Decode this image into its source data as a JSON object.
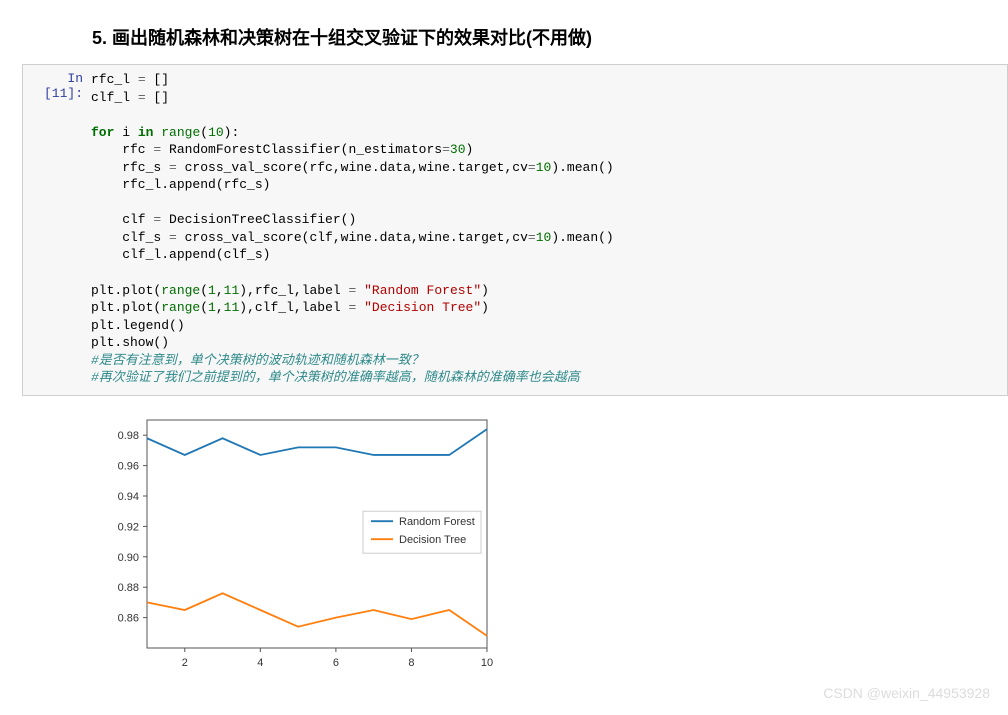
{
  "heading": "5. 画出随机森林和决策树在十组交叉验证下的效果对比(不用做)",
  "prompt": "In [11]:",
  "code": {
    "l1a": "rfc_l ",
    "l1b": "=",
    "l1c": " []",
    "l2a": "clf_l ",
    "l2b": "=",
    "l2c": " []",
    "l3": "",
    "l4a": "for",
    "l4b": " i ",
    "l4c": "in",
    "l4d": " ",
    "l4e": "range",
    "l4f": "(",
    "l4g": "10",
    "l4h": "):",
    "l5a": "    rfc ",
    "l5b": "=",
    "l5c": " RandomForestClassifier(n_estimators",
    "l5d": "=",
    "l5e": "30",
    "l5f": ")",
    "l6a": "    rfc_s ",
    "l6b": "=",
    "l6c": " cross_val_score(rfc,wine.data,wine.target,cv",
    "l6d": "=",
    "l6e": "10",
    "l6f": ").mean()",
    "l7": "    rfc_l.append(rfc_s)",
    "l8": "",
    "l9a": "    clf ",
    "l9b": "=",
    "l9c": " DecisionTreeClassifier()",
    "l10a": "    clf_s ",
    "l10b": "=",
    "l10c": " cross_val_score(clf,wine.data,wine.target,cv",
    "l10d": "=",
    "l10e": "10",
    "l10f": ").mean()",
    "l11": "    clf_l.append(clf_s)",
    "l12": "",
    "l13a": "plt.plot(",
    "l13b": "range",
    "l13c": "(",
    "l13d": "1",
    "l13e": ",",
    "l13f": "11",
    "l13g": "),rfc_l,label ",
    "l13h": "=",
    "l13i": " ",
    "l13j": "\"Random Forest\"",
    "l13k": ")",
    "l14a": "plt.plot(",
    "l14b": "range",
    "l14c": "(",
    "l14d": "1",
    "l14e": ",",
    "l14f": "11",
    "l14g": "),clf_l,label ",
    "l14h": "=",
    "l14i": " ",
    "l14j": "\"Decision Tree\"",
    "l14k": ")",
    "l15": "plt.legend()",
    "l16": "plt.show()",
    "l17": "#是否有注意到，单个决策树的波动轨迹和随机森林一致？",
    "l18": "#再次验证了我们之前提到的，单个决策树的准确率越高，随机森林的准确率也会越高"
  },
  "chart_data": {
    "type": "line",
    "x": [
      1,
      2,
      3,
      4,
      5,
      6,
      7,
      8,
      9,
      10
    ],
    "series": [
      {
        "name": "Random Forest",
        "values": [
          0.978,
          0.967,
          0.978,
          0.967,
          0.972,
          0.972,
          0.967,
          0.967,
          0.967,
          0.984
        ],
        "color": "#1f77b4"
      },
      {
        "name": "Decision Tree",
        "values": [
          0.87,
          0.865,
          0.876,
          0.865,
          0.854,
          0.86,
          0.865,
          0.859,
          0.865,
          0.848
        ],
        "color": "#ff7f0e"
      }
    ],
    "ylim": [
      0.84,
      0.99
    ],
    "yticks": [
      0.86,
      0.88,
      0.9,
      0.92,
      0.94,
      0.96,
      0.98
    ],
    "xticks": [
      2,
      4,
      6,
      8,
      10
    ],
    "legend_pos": "right-mid"
  },
  "watermark": "CSDN @weixin_44953928"
}
